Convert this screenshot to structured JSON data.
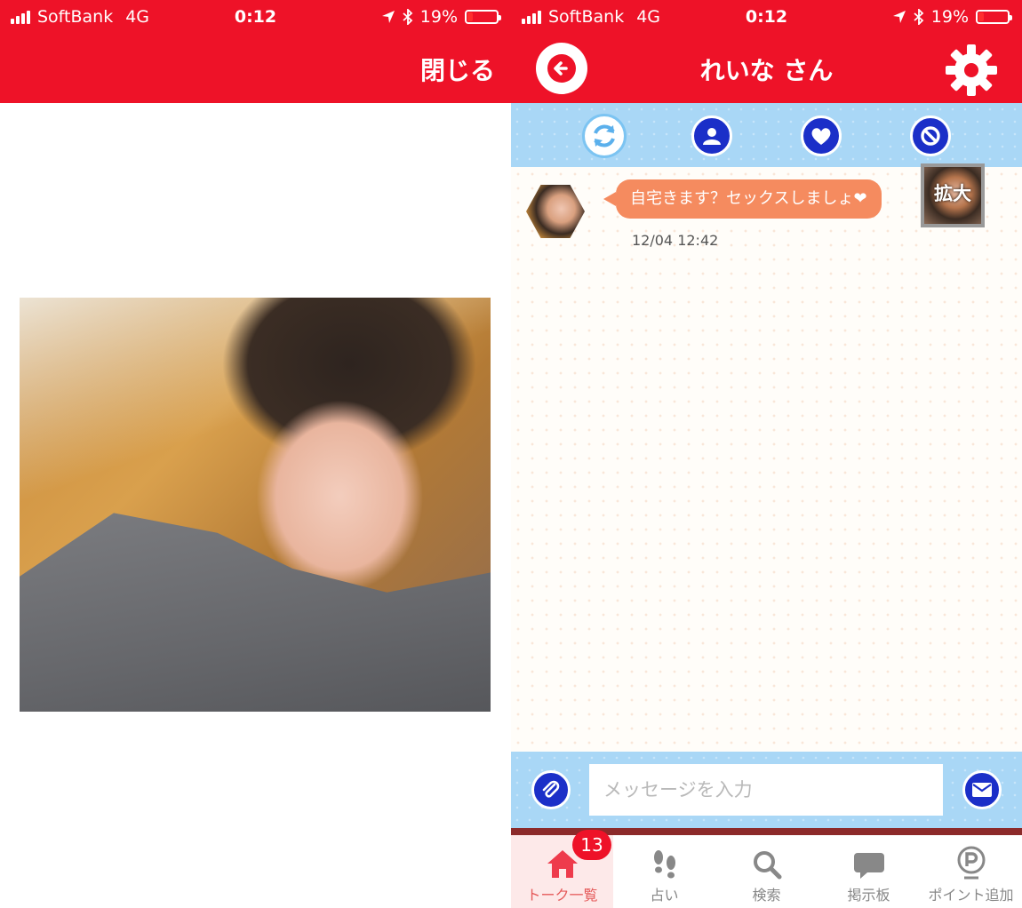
{
  "status_bar": {
    "carrier": "SoftBank",
    "network": "4G",
    "time": "0:12",
    "battery_percent": "19%",
    "battery_level": 0.19
  },
  "left": {
    "close_label": "閉じる"
  },
  "right": {
    "header": {
      "title": "れいな さん"
    },
    "message": {
      "text": "自宅きます？セックスしましょ❤",
      "time": "12/04 12:42",
      "zoom_label": "拡大"
    },
    "input": {
      "placeholder": "メッセージを入力"
    },
    "tabs": [
      {
        "label": "トーク一覧",
        "icon": "home-icon",
        "badge": "13",
        "active": true
      },
      {
        "label": "占い",
        "icon": "footprints-icon"
      },
      {
        "label": "検索",
        "icon": "search-icon"
      },
      {
        "label": "掲示板",
        "icon": "chat-bubble-icon"
      },
      {
        "label": "ポイント追加",
        "icon": "point-icon"
      }
    ]
  },
  "colors": {
    "header_red": "#ee1228",
    "toolbar_blue": "#a9d7f6",
    "icon_blue": "#1b2fc8",
    "bubble_orange": "#f58b5f",
    "active_tab": "#e55a5a"
  }
}
